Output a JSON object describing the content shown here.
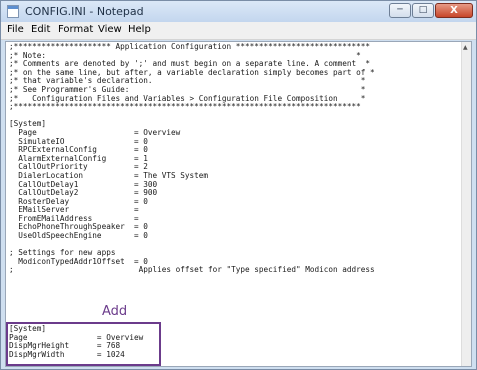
{
  "window": {
    "title": "CONFIG.INI - Notepad",
    "controls": {
      "minimize": "─",
      "maximize": "□",
      "close": "X"
    }
  },
  "menu": [
    "File",
    "Edit",
    "Format",
    "View",
    "Help"
  ],
  "editor": {
    "content": ";********************* Application Configuration *****************************\n;* Note:                                                                   *\n;* Comments are denoted by ';' and must begin on a separate line. A comment  *\n;* on the same line, but after, a variable declaration simply becomes part of *\n;* that variable's declaration.                                             *\n;* See Programmer's Guide:                                                  *\n;*   Configuration Files and Variables > Configuration File Composition     *\n;***************************************************************************\n\n[System]\n  Page                     = Overview\n  SimulateIO               = 0\n  RPCExternalConfig        = 0\n  AlarmExternalConfig      = 1\n  CallOutPriority          = 2\n  DialerLocation           = The VTS System\n  CallOutDelay1            = 300\n  CallOutDelay2            = 900\n  RosterDelay              = 0\n  EMailServer              =\n  FromEMailAddress         =\n  EchoPhoneThroughSpeaker  = 0\n  UseOldSpeechEngine       = 0\n\n; Settings for new apps\n  ModiconTypedAddr1Offset  = 0\n;                           Applies offset for \"Type specified\" Modicon address",
    "added_content": "[System]\nPage               = Overview\nDispMgrHeight      = 768\nDispMgrWidth       = 1024"
  },
  "annotation": {
    "label": "Add",
    "color": "#6b3b8b"
  }
}
